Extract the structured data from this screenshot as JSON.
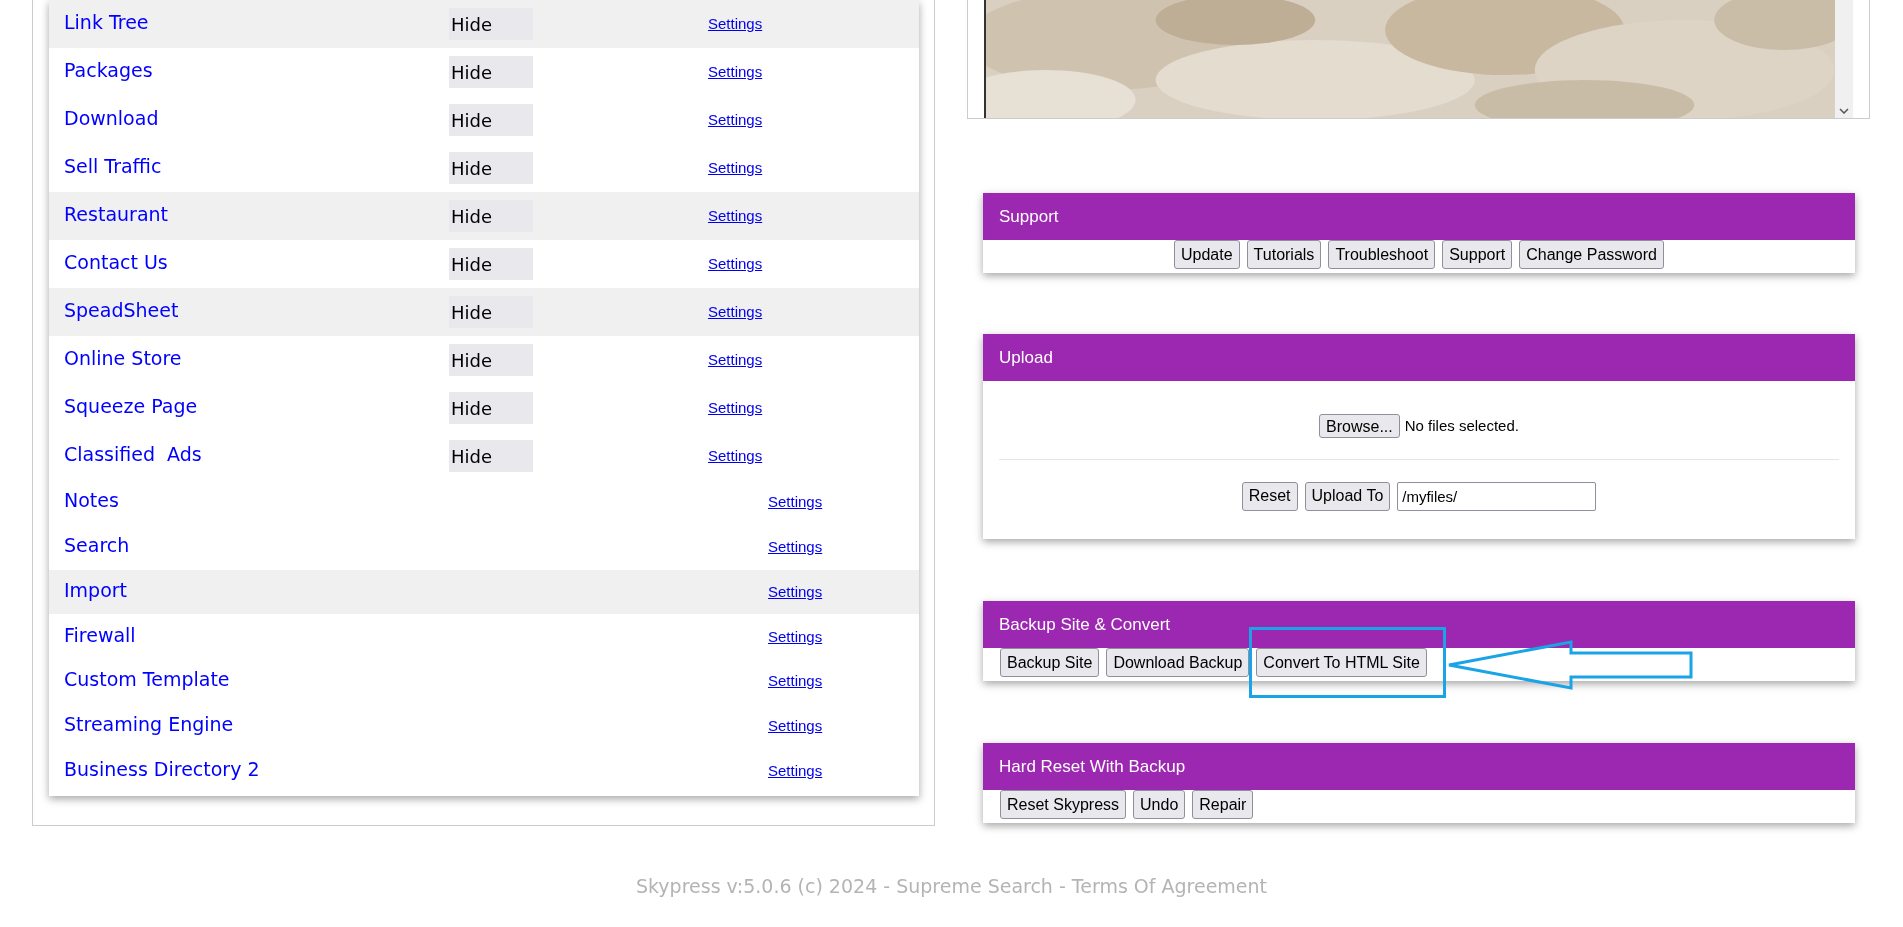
{
  "modules": [
    {
      "kind": "toggle",
      "name": "Link Tree",
      "hide": "Hide",
      "link": "Settings",
      "shaded": true
    },
    {
      "kind": "toggle",
      "name": "Packages",
      "hide": "Hide",
      "link": "Settings",
      "shaded": false
    },
    {
      "kind": "toggle",
      "name": "Download",
      "hide": "Hide",
      "link": "Settings",
      "shaded": false
    },
    {
      "kind": "toggle",
      "name": "Sell Traffic",
      "hide": "Hide",
      "link": "Settings",
      "shaded": false
    },
    {
      "kind": "toggle",
      "name": "Restaurant",
      "hide": "Hide",
      "link": "Settings",
      "shaded": true
    },
    {
      "kind": "toggle",
      "name": "Contact Us",
      "hide": "Hide",
      "link": "Settings",
      "shaded": false
    },
    {
      "kind": "toggle",
      "name": "SpeadSheet",
      "hide": "Hide",
      "link": "Settings",
      "shaded": true
    },
    {
      "kind": "toggle",
      "name": "Online Store",
      "hide": "Hide",
      "link": "Settings",
      "shaded": false
    },
    {
      "kind": "toggle",
      "name": "Squeeze Page",
      "hide": "Hide",
      "link": "Settings",
      "shaded": false
    },
    {
      "kind": "toggle",
      "name": "Classified  Ads",
      "hide": "Hide",
      "link": "Settings",
      "shaded": false
    },
    {
      "kind": "plain",
      "name": "Notes",
      "link": "Settings",
      "shaded": false
    },
    {
      "kind": "plain",
      "name": "Search",
      "link": "Settings",
      "shaded": false
    },
    {
      "kind": "plain",
      "name": "Import",
      "link": "Settings",
      "shaded": true
    },
    {
      "kind": "plain",
      "name": "Firewall",
      "link": "Settings",
      "shaded": false
    },
    {
      "kind": "plain",
      "name": "Custom Template",
      "link": "Settings",
      "shaded": false
    },
    {
      "kind": "plain",
      "name": "Streaming Engine",
      "link": "Settings",
      "shaded": false
    },
    {
      "kind": "plain",
      "name": "Business Directory 2",
      "link": "Settings",
      "shaded": false
    }
  ],
  "panels": [
    {
      "kind": "centered",
      "title": "Support",
      "buttons": [
        {
          "label": "Update",
          "annotated": false
        },
        {
          "label": "Tutorials",
          "annotated": false
        },
        {
          "label": "Troubleshoot",
          "annotated": false
        },
        {
          "label": "Support",
          "annotated": false
        },
        {
          "label": "Change Password",
          "annotated": false
        }
      ]
    },
    {
      "kind": "upload",
      "title": "Upload",
      "browse": "Browse...",
      "file_status": "No files selected.",
      "reset": "Reset",
      "upload": "Upload To",
      "path": "/myfiles/"
    },
    {
      "kind": "buttons",
      "title": "Backup Site & Convert",
      "buttons": [
        {
          "label": "Backup Site",
          "annotated": false
        },
        {
          "label": "Download Backup",
          "annotated": false
        },
        {
          "label": "Convert To HTML Site",
          "annotated": true
        }
      ]
    },
    {
      "kind": "buttons",
      "title": "Hard Reset With Backup",
      "buttons": [
        {
          "label": "Reset Skypress",
          "annotated": false
        },
        {
          "label": "Undo",
          "annotated": false
        },
        {
          "label": "Repair",
          "annotated": false
        }
      ]
    }
  ],
  "footer": "Skypress v:5.0.6 (c) 2024 - Supreme Search - Terms Of Agreement"
}
